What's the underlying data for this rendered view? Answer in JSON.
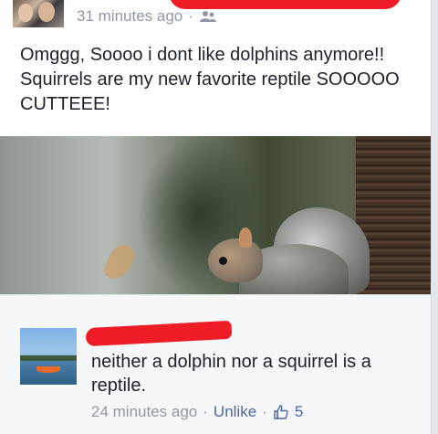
{
  "post": {
    "timestamp": "31 minutes ago",
    "separator": "·",
    "text": "Omggg, Soooo i dont like dolphins anymore!! Squirrels are my new favorite reptile SOOOOO CUTTEEE!"
  },
  "comment": {
    "text": "neither a dolphin nor a squirrel is a reptile.",
    "timestamp": "24 minutes ago",
    "separator": "·",
    "unlike_label": "Unlike",
    "separator2": "·",
    "like_count": "5"
  },
  "icons": {
    "audience": "friends-icon",
    "like": "thumbs-up-icon"
  },
  "colors": {
    "redaction": "#ee1c24",
    "link": "#4b67a1",
    "meta": "#9197a3"
  }
}
